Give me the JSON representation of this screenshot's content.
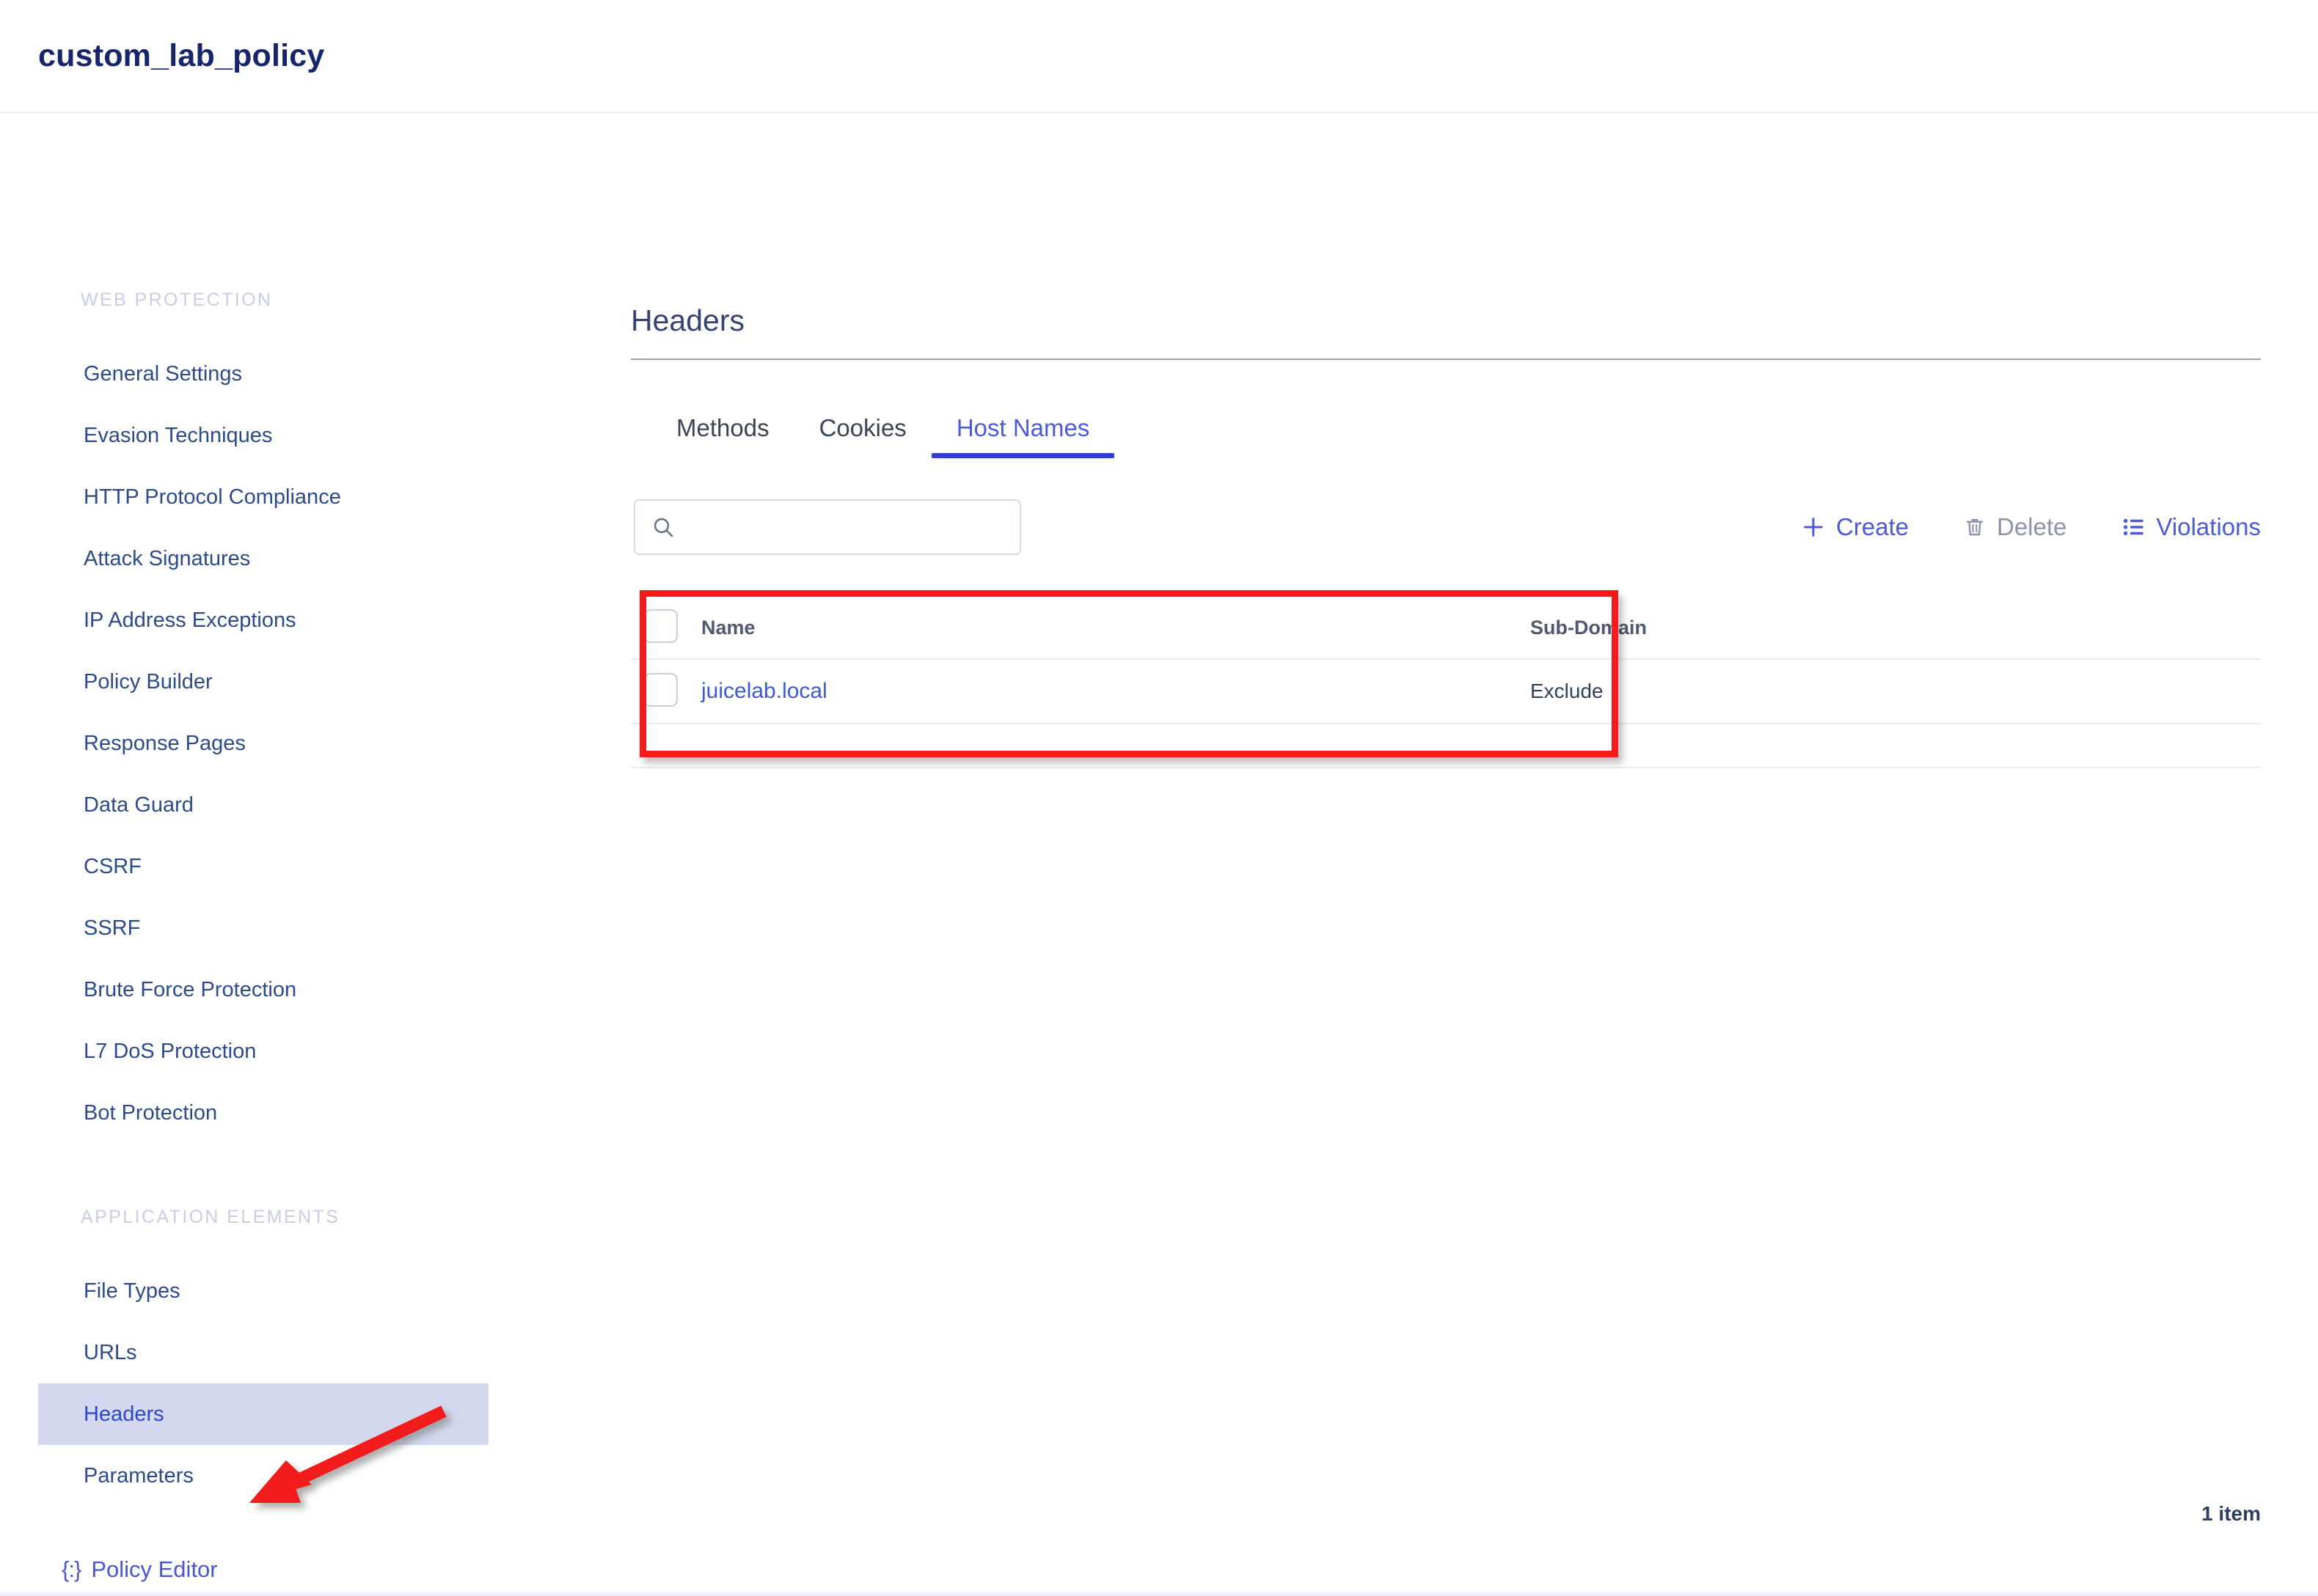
{
  "header": {
    "title": "custom_lab_policy"
  },
  "sidebar": {
    "sections": [
      {
        "label": "WEB PROTECTION",
        "items": [
          {
            "label": "General Settings",
            "active": false
          },
          {
            "label": "Evasion Techniques",
            "active": false
          },
          {
            "label": "HTTP Protocol Compliance",
            "active": false
          },
          {
            "label": "Attack Signatures",
            "active": false
          },
          {
            "label": "IP Address Exceptions",
            "active": false
          },
          {
            "label": "Policy Builder",
            "active": false
          },
          {
            "label": "Response Pages",
            "active": false
          },
          {
            "label": "Data Guard",
            "active": false
          },
          {
            "label": "CSRF",
            "active": false
          },
          {
            "label": "SSRF",
            "active": false
          },
          {
            "label": "Brute Force Protection",
            "active": false
          },
          {
            "label": "L7 DoS Protection",
            "active": false
          },
          {
            "label": "Bot Protection",
            "active": false
          }
        ]
      },
      {
        "label": "APPLICATION ELEMENTS",
        "items": [
          {
            "label": "File Types",
            "active": false
          },
          {
            "label": "URLs",
            "active": false
          },
          {
            "label": "Headers",
            "active": true
          },
          {
            "label": "Parameters",
            "active": false
          }
        ]
      }
    ],
    "policy_editor": {
      "label": "Policy Editor",
      "icon": "curly-braces-icon"
    }
  },
  "main": {
    "panel_title": "Headers",
    "tabs": [
      {
        "label": "Methods",
        "active": false
      },
      {
        "label": "Cookies",
        "active": false
      },
      {
        "label": "Host Names",
        "active": true
      }
    ],
    "search": {
      "value": "",
      "placeholder": "",
      "icon": "search-icon"
    },
    "toolbar": [
      {
        "label": "Create",
        "icon": "plus-icon",
        "disabled": false
      },
      {
        "label": "Delete",
        "icon": "trash-icon",
        "disabled": true
      },
      {
        "label": "Violations",
        "icon": "list-icon",
        "disabled": false
      }
    ],
    "table": {
      "columns": [
        "Name",
        "Sub-Domain"
      ],
      "rows": [
        {
          "name": "juicelab.local",
          "sub_domain": "Exclude",
          "selected": false
        }
      ]
    },
    "item_count": "1 item"
  },
  "annotations": {
    "arrow_color": "#f31b1b",
    "highlight_rect_color": "#f31b1b"
  },
  "colors": {
    "accent_blue": "#4b5ad8",
    "title_navy": "#17256b",
    "active_nav_bg": "#d3d8ef",
    "annotation_red": "#f31b1b"
  }
}
